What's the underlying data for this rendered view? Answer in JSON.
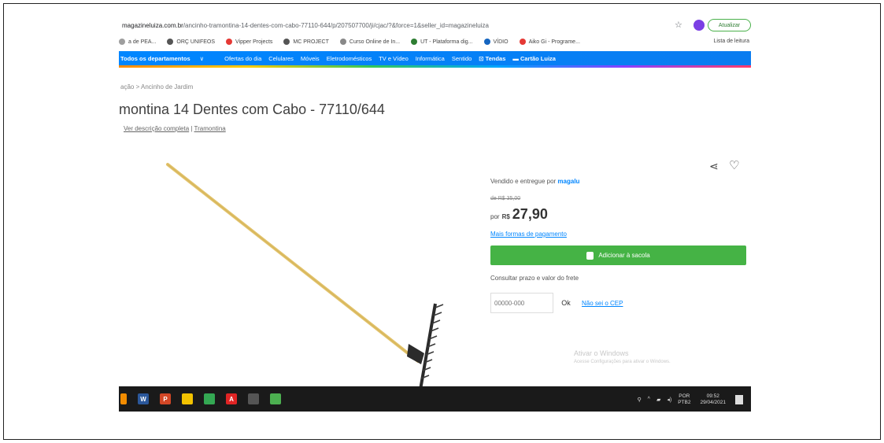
{
  "browser": {
    "url_domain": "magazineluiza.com.br",
    "url_path": "/ancinho-tramontina-14-dentes-com-cabo-77110-644/p/207507700/ji/cjac/?&force=1&seller_id=magazineluiza",
    "update_label": "Atualizar"
  },
  "bookmarks": [
    {
      "label": "a de PEA...",
      "color": "#9e9e9e"
    },
    {
      "label": "ORÇ UNIFEOS",
      "color": "#555555"
    },
    {
      "label": "Vipper Projects",
      "color": "#e53935"
    },
    {
      "label": "MC PROJECT",
      "color": "#555555"
    },
    {
      "label": "Curso Online de In...",
      "color": "#888888"
    },
    {
      "label": "UT - Plataforma dig...",
      "color": "#2e7d32"
    },
    {
      "label": "VÍDIO",
      "color": "#1565c0"
    },
    {
      "label": "Aiko Gi - Programe...",
      "color": "#e53935"
    }
  ],
  "bookmarks_right": "Lista de leitura",
  "nav": {
    "departments": "Todos os departamentos",
    "items": [
      "Ofertas do dia",
      "Celulares",
      "Móveis",
      "Eletrodomésticos",
      "TV e Vídeo",
      "Informática",
      "Sentido"
    ],
    "featured1": "Tendas",
    "featured2": "Cartão Luiza"
  },
  "page": {
    "breadcrumb": "ação  >  Ancinho de Jardim",
    "title": "montina 14 Dentes com Cabo - 77110/644",
    "full_description": "Ver descrição completa",
    "separator": "|",
    "brand": "Tramontina"
  },
  "buy_box": {
    "seller_prefix": "Vendido e entregue por",
    "seller_name": "magalu",
    "old_price": "de R$ 35,00",
    "price_prefix": "por",
    "currency": "R$",
    "price": "27,90",
    "installments_link": "Mais formas de pagamento",
    "add_button": "Adicionar à sacola",
    "freight_label": "Consultar prazo e valor do frete",
    "cep_placeholder": "00000-000",
    "ok_label": "Ok",
    "no_cep_link": "Não sei o CEP"
  },
  "windows": {
    "activate_title": "Ativar o Windows",
    "activate_sub": "Acesse Configurações para ativar o Windows."
  },
  "taskbar": {
    "icons": [
      {
        "name": "word",
        "color": "#2b579a",
        "glyph": "W"
      },
      {
        "name": "powerpoint",
        "color": "#d24726",
        "glyph": "P"
      },
      {
        "name": "files",
        "color": "#f2c200",
        "glyph": ""
      },
      {
        "name": "chrome",
        "color": "#34a853",
        "glyph": ""
      },
      {
        "name": "acrobat",
        "color": "#e02424",
        "glyph": "A"
      },
      {
        "name": "app",
        "color": "#555555",
        "glyph": ""
      },
      {
        "name": "photos",
        "color": "#4caf50",
        "glyph": ""
      }
    ],
    "lang": "POR",
    "lang2": "PTB2",
    "time": "09:52",
    "date": "29/04/2021"
  }
}
